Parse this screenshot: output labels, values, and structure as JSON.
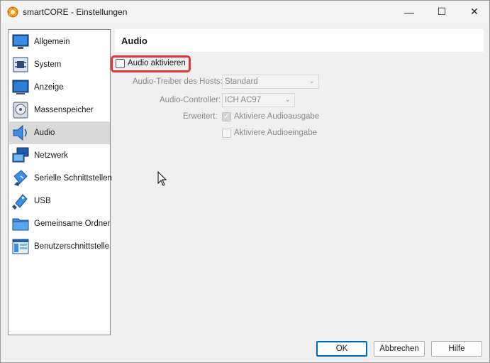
{
  "window": {
    "title": "smartCORE - Einstellungen",
    "min_glyph": "—",
    "max_glyph": "☐",
    "close_glyph": "✕"
  },
  "sidebar": {
    "items": [
      {
        "label": "Allgemein",
        "icon": "general-icon",
        "selected": false
      },
      {
        "label": "System",
        "icon": "system-icon",
        "selected": false
      },
      {
        "label": "Anzeige",
        "icon": "display-icon",
        "selected": false
      },
      {
        "label": "Massenspeicher",
        "icon": "storage-icon",
        "selected": false
      },
      {
        "label": "Audio",
        "icon": "audio-icon",
        "selected": true
      },
      {
        "label": "Netzwerk",
        "icon": "network-icon",
        "selected": false
      },
      {
        "label": "Serielle Schnittstellen",
        "icon": "serial-ports-icon",
        "selected": false
      },
      {
        "label": "USB",
        "icon": "usb-icon",
        "selected": false
      },
      {
        "label": "Gemeinsame Ordner",
        "icon": "shared-folder-icon",
        "selected": false
      },
      {
        "label": "Benutzerschnittstelle",
        "icon": "user-interface-icon",
        "selected": false
      }
    ]
  },
  "panel": {
    "title": "Audio",
    "enable_audio": {
      "label": "Audio aktivieren",
      "checked": false
    },
    "host_driver": {
      "label": "Audio-Treiber des Hosts:",
      "value": "Standard"
    },
    "controller": {
      "label": "Audio-Controller:",
      "value": "ICH AC97"
    },
    "extended": {
      "label": "Erweitert:",
      "output": {
        "label": "Aktiviere Audioausgabe",
        "checked": true
      },
      "input": {
        "label": "Aktiviere Audioeingabe",
        "checked": false
      }
    }
  },
  "buttons": {
    "ok": "OK",
    "cancel": "Abbrechen",
    "help": "Hilfe"
  },
  "colors": {
    "highlight": "#e0353b",
    "selected_item": "#d9d9d9",
    "default_button_border": "#0067c0"
  }
}
